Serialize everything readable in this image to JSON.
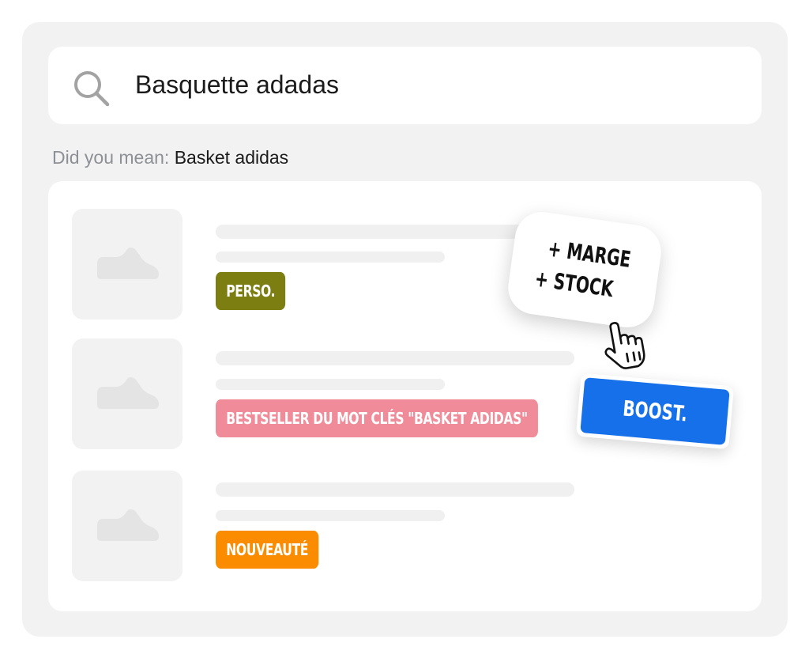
{
  "search": {
    "value": "Basquette adadas",
    "icon": "search-icon"
  },
  "suggestion": {
    "prefix": "Did you mean:",
    "term": "Basket adidas"
  },
  "results": [
    {
      "thumbnail_icon": "sneaker-icon",
      "tag": "PERSO.",
      "tag_color": "#7d7e12"
    },
    {
      "thumbnail_icon": "sneaker-icon",
      "tag": "BESTSELLER DU MOT CLÉS \"BASKET ADIDAS\"",
      "tag_color": "#f08c99"
    },
    {
      "thumbnail_icon": "sneaker-icon",
      "tag": "NOUVEAUTÉ",
      "tag_color": "#fb8c00"
    }
  ],
  "callout": {
    "line1": "+ MARGE",
    "line2": "+ STOCK"
  },
  "boost_button": {
    "label": "BOOST.",
    "color": "#1670ea"
  },
  "cursor_icon": "hand-pointer-icon"
}
